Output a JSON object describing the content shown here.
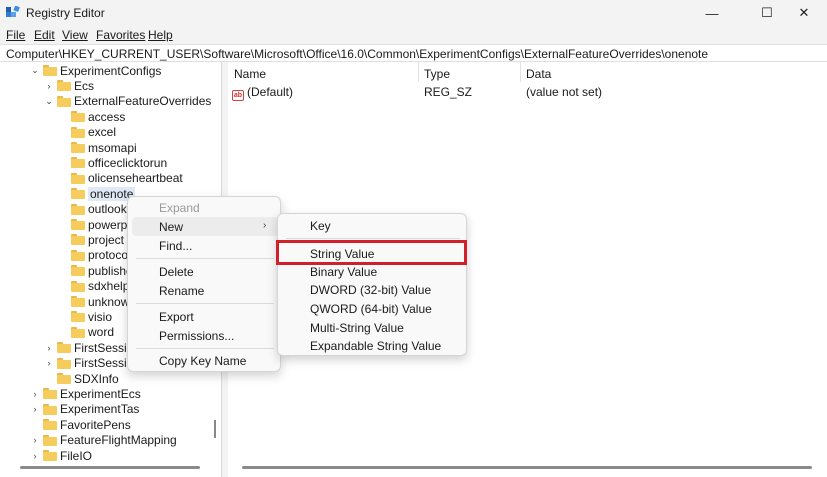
{
  "window": {
    "title": "Registry Editor",
    "minimize": "—",
    "maximize": "☐",
    "close": "✕"
  },
  "menu": [
    "File",
    "Edit",
    "View",
    "Favorites",
    "Help"
  ],
  "address": "Computer\\HKEY_CURRENT_USER\\Software\\Microsoft\\Office\\16.0\\Common\\ExperimentConfigs\\ExternalFeatureOverrides\\onenote",
  "tree": [
    {
      "label": "ExperimentConfigs",
      "chev": "v"
    },
    {
      "label": "Ecs",
      "chev": ">"
    },
    {
      "label": "ExternalFeatureOverrides",
      "chev": "v"
    },
    {
      "label": "access",
      "chev": ""
    },
    {
      "label": "excel",
      "chev": ""
    },
    {
      "label": "msomapi",
      "chev": ""
    },
    {
      "label": "officeclicktorun",
      "chev": ""
    },
    {
      "label": "olicenseheartbeat",
      "chev": ""
    },
    {
      "label": "onenote",
      "chev": ""
    },
    {
      "label": "outlook",
      "chev": ""
    },
    {
      "label": "powerpo",
      "chev": ""
    },
    {
      "label": "project",
      "chev": ""
    },
    {
      "label": "protocol",
      "chev": ""
    },
    {
      "label": "publishe",
      "chev": ""
    },
    {
      "label": "sdxhelpe",
      "chev": ""
    },
    {
      "label": "unknow",
      "chev": ""
    },
    {
      "label": "visio",
      "chev": ""
    },
    {
      "label": "word",
      "chev": ""
    },
    {
      "label": "FirstSession",
      "chev": ">"
    },
    {
      "label": "FirstSession",
      "chev": ">"
    },
    {
      "label": "SDXInfo",
      "chev": ""
    },
    {
      "label": "ExperimentEcs",
      "chev": ">"
    },
    {
      "label": "ExperimentTas",
      "chev": ">"
    },
    {
      "label": "FavoritePens",
      "chev": ""
    },
    {
      "label": "FeatureFlightMapping",
      "chev": ">"
    },
    {
      "label": "FileIO",
      "chev": ">"
    }
  ],
  "columns": {
    "name": "Name",
    "type": "Type",
    "data": "Data"
  },
  "values": [
    {
      "icon": "ab",
      "name": "(Default)",
      "type": "REG_SZ",
      "data": "(value not set)"
    }
  ],
  "context_menu": {
    "expand": "Expand",
    "new": "New",
    "find": "Find...",
    "delete": "Delete",
    "rename": "Rename",
    "export": "Export",
    "permissions": "Permissions...",
    "copy_key_name": "Copy Key Name",
    "arrow": "›"
  },
  "submenu": {
    "key": "Key",
    "string_value": "String Value",
    "binary_value": "Binary Value",
    "dword_value": "DWORD (32-bit) Value",
    "qword_value": "QWORD (64-bit) Value",
    "multi_string_value": "Multi-String Value",
    "expandable_string_value": "Expandable String Value"
  },
  "colors": {
    "highlight_box": "#d0202a",
    "folder": "#f6cd5c",
    "selection": "#dfe8f5"
  }
}
